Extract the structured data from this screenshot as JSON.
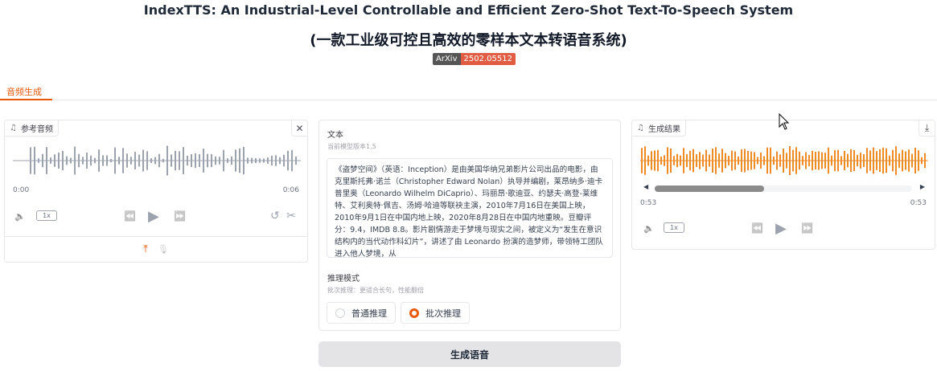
{
  "header": {
    "title": "IndexTTS: An Industrial-Level Controllable and Efficient Zero-Shot Text-To-Speech System",
    "subtitle": "(一款工业级可控且高效的零样本文本转语音系统)",
    "badge_left": "ArXiv",
    "badge_right": "2502.05512"
  },
  "tabs": [
    {
      "label": "音频生成",
      "active": true
    }
  ],
  "reference_audio": {
    "label": "参考音频",
    "time_start": "0:00",
    "time_end": "0:06",
    "rate": "1x",
    "wave_color": "#9ca3af"
  },
  "text_panel": {
    "label": "文本",
    "info": "当前模型版本1.5",
    "content": "《盗梦空间》（英语：Inception）是由美国华纳兄弟影片公司出品的电影，由克里斯托弗·诺兰（Christopher Edward Nolan）执导并编剧，莱昂纳多·迪卡普里奥（Leonardo Wilhelm DiCaprio）、玛丽昂·歌迪亚、约瑟夫·高登-莱维特、艾利奥特·佩吉、汤姆·哈迪等联袂主演，2010年7月16日在美国上映，2010年9月1日在中国内地上映，2020年8月28日在中国内地重映。豆瓣评分：9.4，IMDB 8.8。影片剧情游走于梦境与现实之间，被定义为“发生在意识结构内的当代动作科幻片”，讲述了由 Leonardo 扮演的造梦师，带领特工团队进入他人梦境，从",
    "mode_label": "推理模式",
    "mode_info": "批次推理：更适合长句，性能翻倍",
    "modes": [
      {
        "label": "普通推理",
        "selected": false
      },
      {
        "label": "批次推理",
        "selected": true
      }
    ]
  },
  "result_audio": {
    "label": "生成结果",
    "time_start": "0:53",
    "time_end": "0:53",
    "rate": "1x",
    "wave_color": "#f08a24"
  },
  "generate_button": {
    "label": "生成语音"
  },
  "icons": {
    "note": "♫",
    "close": "✕",
    "download": "⤓",
    "volume": "🔈",
    "rewind": "⏪",
    "play": "▶",
    "forward": "⏩",
    "undo": "↺",
    "scissors": "✂",
    "upload": "⤒",
    "mic": "🎙",
    "tri_left": "◀",
    "tri_right": "▶"
  },
  "colors": {
    "accent": "#ea580c"
  }
}
